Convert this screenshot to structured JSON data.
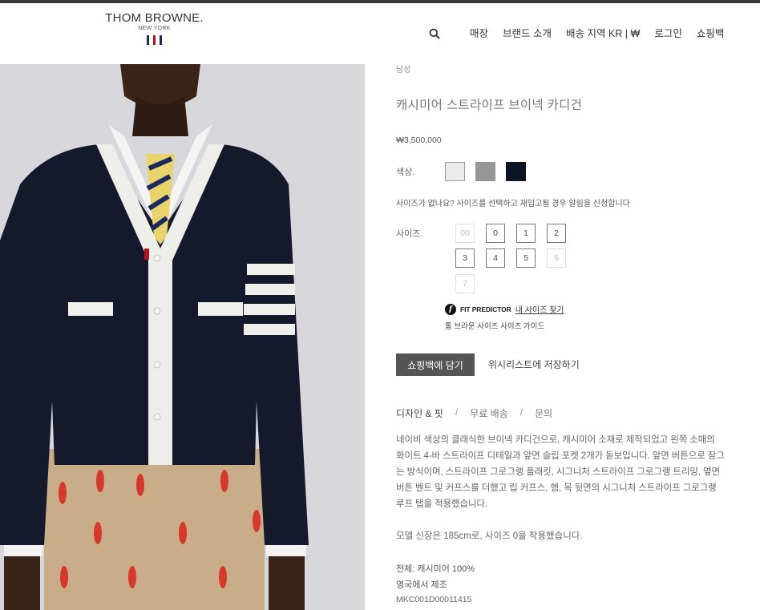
{
  "header": {
    "logo_main": "THOM BROWNE.",
    "logo_sub": "NEW YORK",
    "nav": [
      "매장",
      "브랜드 소개",
      "배송 지역 KR | ₩",
      "로그인",
      "쇼핑백"
    ]
  },
  "product": {
    "category": "남성",
    "title": "캐시미어 스트라이프 브이넥 카디건",
    "price": "₩3,500,000",
    "color_label": "색상.",
    "colors": [
      "#ebebeb",
      "#969696",
      "#0d1424"
    ],
    "size_notice": "사이즈가 없나요? 사이즈를 선택하고 재입고될 경우 알림을 신청합니다",
    "size_label": "사이즈.",
    "sizes": [
      {
        "label": "00",
        "available": false
      },
      {
        "label": "0",
        "available": true
      },
      {
        "label": "1",
        "available": true
      },
      {
        "label": "2",
        "available": true
      },
      {
        "label": "3",
        "available": true
      },
      {
        "label": "4",
        "available": true
      },
      {
        "label": "5",
        "available": true
      },
      {
        "label": "6",
        "available": false
      },
      {
        "label": "7",
        "available": false
      }
    ],
    "fit_brand": "FIT PREDICTOR",
    "fit_link": "내 사이즈 찾기",
    "size_guide": "톰 브라운 사이즈 사이즈 가이드",
    "add_to_bag": "쇼핑백에 담기",
    "wishlist": "위시리스트에 저장하기",
    "tabs": [
      "디자인 & 핏",
      "무료 배송",
      "문의"
    ],
    "description": "네이비 색상의 클래식한 브이넥 카디건으로, 캐시미어 소재로 제작되었고 왼쪽 소매의 화이트 4-바 스트라이프 디테일과 앞면 슬립 포켓 2개가 돋보입니다. 앞면 버튼으로 잠그는 방식이며, 스트라이프 그로그랭 플래킷, 시그니처 스트라이프 그로그랭 트리밍, 옆면 버튼 벤트 및 커프스를 더했고 립 커프스, 헴, 목 뒷면의 시그니처 스트라이프 그로그랭 루프 탭을 적용했습니다.",
    "model_info": "모델 신장은 185cm로, 사이즈 0을 착용했습니다.",
    "composition": "전체: 캐시미어 100%",
    "origin": "영국에서 제조",
    "sku": "MKC001D00011415"
  }
}
